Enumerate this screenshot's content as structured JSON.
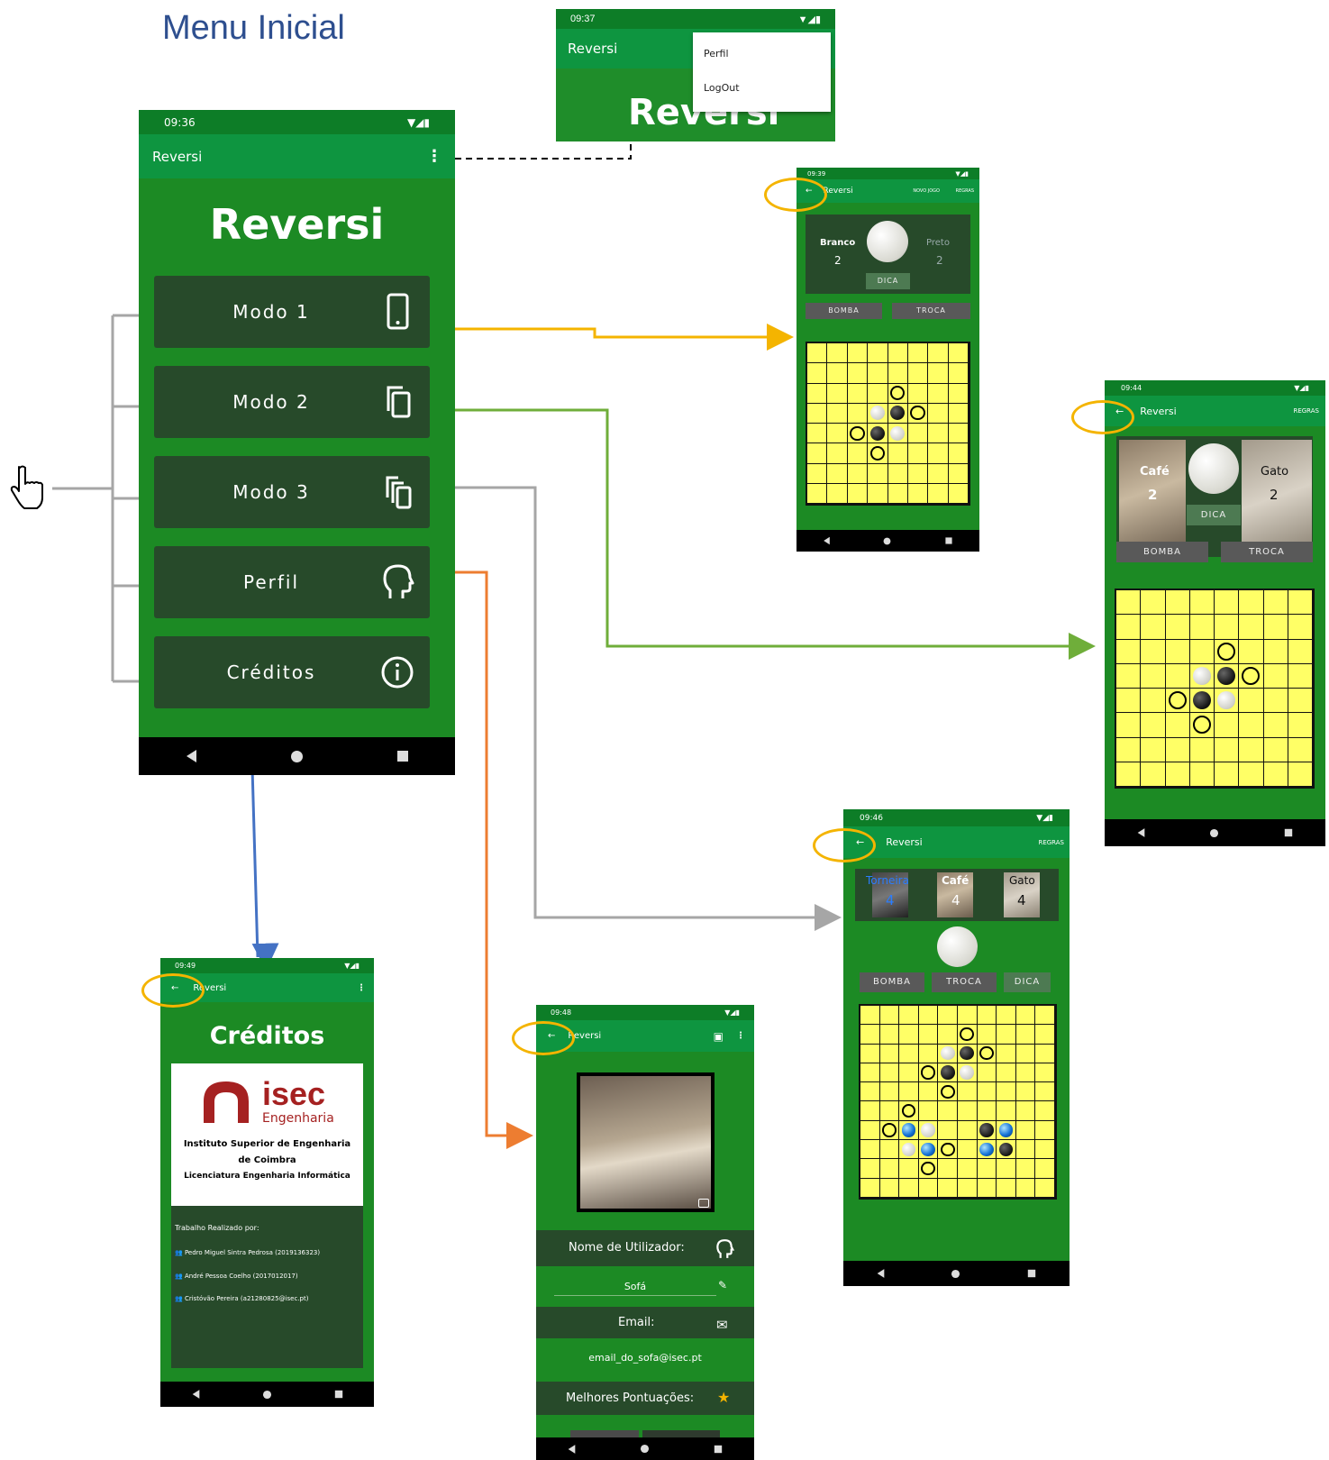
{
  "heading": "Menu Inicial",
  "colors": {
    "appbar": "#0e9540",
    "screen": "#1c8a24",
    "panel": "#274a2a",
    "board": "#ffff66",
    "accent": "#f4b400"
  },
  "popup": {
    "time": "09:37",
    "app": "Reversi",
    "items": [
      "Perfil",
      "LogOut"
    ],
    "bg_title": "Reversi"
  },
  "main": {
    "time": "09:36",
    "app": "Reversi",
    "title": "Reversi",
    "buttons": [
      {
        "label": "Modo 1",
        "icon": "phone-icon"
      },
      {
        "label": "Modo 2",
        "icon": "copy-icon"
      },
      {
        "label": "Modo 3",
        "icon": "multi-device-icon"
      },
      {
        "label": "Perfil",
        "icon": "head-icon"
      },
      {
        "label": "Créditos",
        "icon": "info-icon"
      }
    ]
  },
  "mode1": {
    "time": "09:39",
    "app": "Reversi",
    "actions": [
      "NOVO JOGO",
      "REGRAS"
    ],
    "p1": "Branco",
    "p1score": "2",
    "p2": "Preto",
    "p2score": "2",
    "hint": "DICA",
    "bomb": "BOMBA",
    "swap": "TROCA"
  },
  "mode2": {
    "time": "09:44",
    "app": "Reversi",
    "action": "REGRAS",
    "p1": "Café",
    "p1score": "2",
    "p2": "Gato",
    "p2score": "2",
    "hint": "DICA",
    "bomb": "BOMBA",
    "swap": "TROCA"
  },
  "mode3": {
    "time": "09:46",
    "app": "Reversi",
    "action": "REGRAS",
    "p1": "Torneira",
    "p1score": "4",
    "p2": "Café",
    "p2score": "4",
    "p3": "Gato",
    "p3score": "4",
    "bomb": "BOMBA",
    "swap": "TROCA",
    "hint": "DICA"
  },
  "credits": {
    "time": "09:49",
    "app": "Reversi",
    "title": "Créditos",
    "logo1": "isec",
    "logo2": "Engenharia",
    "inst": "Instituto Superior de Engenharia de Coimbra",
    "course": "Licenciatura Engenharia Informática",
    "by": "Trabalho Realizado por:",
    "authors": [
      "Pedro Miguel Sintra Pedrosa (2019136323)",
      "André Pessoa Coelho (2017012017)",
      "Cristóvão Pereira (a21280825@isec.pt)"
    ]
  },
  "profile": {
    "time": "09:48",
    "app": "Reversi",
    "user_label": "Nome de Utilizador:",
    "user": "Sofá",
    "email_label": "Email:",
    "email": "email_do_sofa@isec.pt",
    "scores_label": "Melhores Pontuações:"
  }
}
